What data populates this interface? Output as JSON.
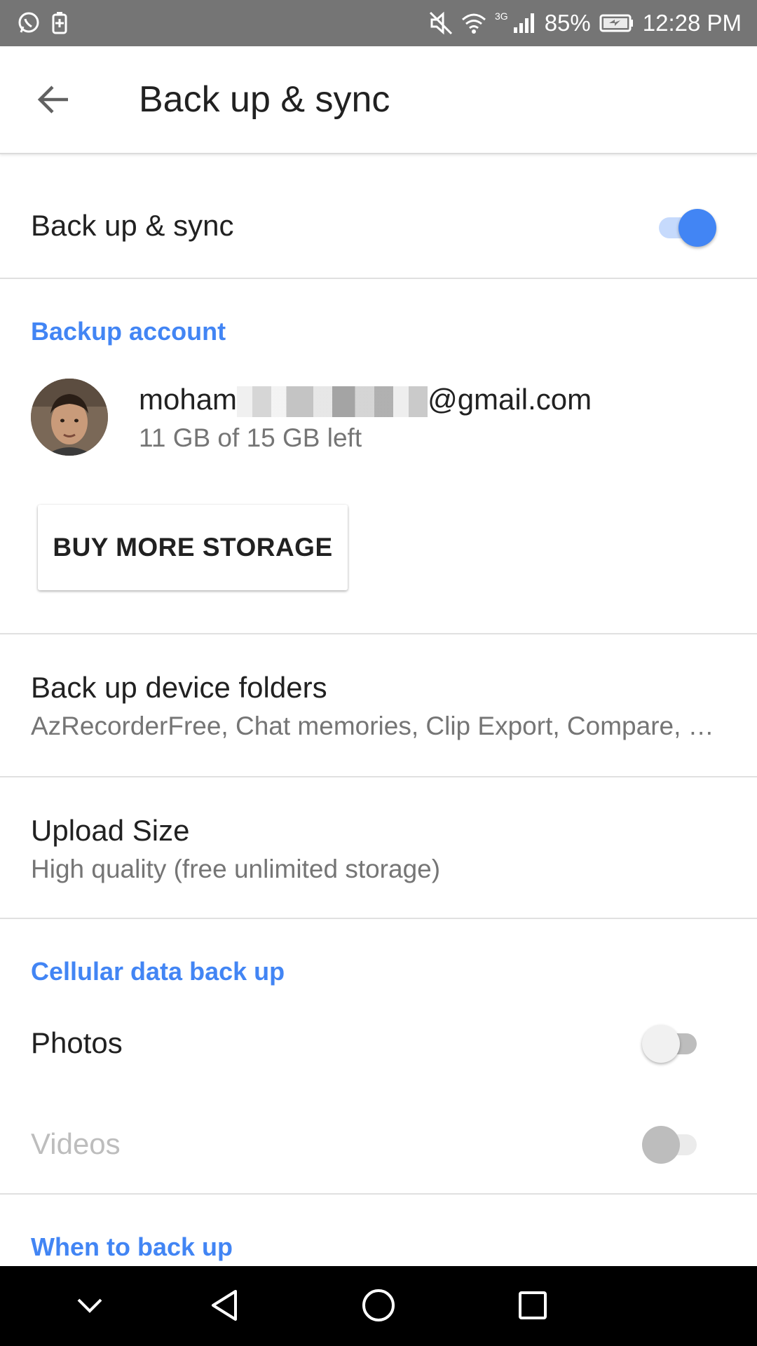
{
  "status_bar": {
    "left_icons": [
      "whatsapp-icon",
      "battery-saver-icon"
    ],
    "right_icons": [
      "mute-icon",
      "wifi-icon",
      "signal-icon",
      "battery-charging-icon"
    ],
    "network_type": "3G",
    "battery": "85%",
    "time": "12:28 PM"
  },
  "app_bar": {
    "back_icon": "arrow-back-icon",
    "title": "Back up & sync"
  },
  "settings": {
    "backup_sync": {
      "label": "Back up & sync",
      "enabled": true
    },
    "backup_account": {
      "header": "Backup account",
      "email_prefix": "moham",
      "email_suffix": "@gmail.com",
      "storage": "11 GB of 15 GB left",
      "buy_button": "BUY MORE STORAGE"
    },
    "device_folders": {
      "title": "Back up device folders",
      "summary": "AzRecorderFree, Chat memories, Clip Export, Compare, …"
    },
    "upload_size": {
      "title": "Upload Size",
      "summary": "High quality (free unlimited storage)"
    },
    "cellular": {
      "header": "Cellular data back up",
      "photos": {
        "label": "Photos",
        "enabled": false
      },
      "videos": {
        "label": "Videos",
        "enabled": false,
        "disabled": true
      }
    },
    "when_to_backup": {
      "header": "When to back up"
    }
  },
  "nav_bar": {
    "buttons": [
      "chevron-down-icon",
      "back-triangle-icon",
      "home-circle-icon",
      "recents-square-icon"
    ]
  },
  "colors": {
    "accent": "#4285f4",
    "status_bar": "#757575",
    "nav_bar": "#000000"
  }
}
